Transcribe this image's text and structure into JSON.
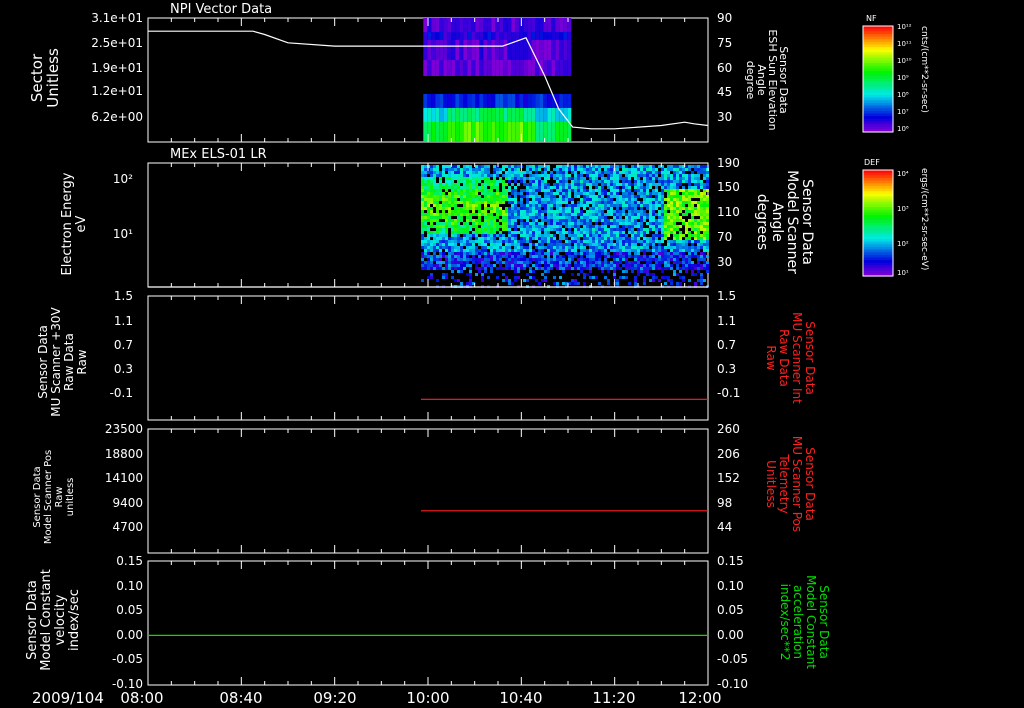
{
  "colors": {
    "background": "#000000",
    "axis": "#ffffff",
    "red": "#ff2020",
    "green": "#00e000"
  },
  "time_axis": {
    "date_label": "2009/104",
    "tick_labels": [
      "08:00",
      "08:40",
      "09:20",
      "10:00",
      "10:40",
      "11:20",
      "12:00"
    ],
    "range_minutes": [
      480,
      720
    ]
  },
  "chart_data": [
    {
      "type": "heatmap",
      "title": "NPI Vector Data",
      "ylabel_left": [
        "Sector",
        "Unitless"
      ],
      "left_tick_labels": [
        "3.1e+01",
        "2.5e+01",
        "1.9e+01",
        "1.2e+01",
        "6.2e+00"
      ],
      "ylabel_right": [
        "Sensor Data",
        "ESH Sun Elevation",
        "Angle",
        "degree"
      ],
      "right_tick_labels": [
        "90",
        "75",
        "60",
        "45",
        "30"
      ],
      "right_ylim": [
        15,
        90
      ],
      "heatmap_extent_minutes": [
        598,
        660
      ],
      "line_series": {
        "name": "ESH Sun Elevation Angle",
        "x": [
          480,
          525,
          530,
          540,
          560,
          600,
          620,
          632,
          636,
          642,
          650,
          656,
          662,
          670,
          680,
          700,
          710,
          714,
          720
        ],
        "y": [
          82,
          82,
          80,
          75,
          73,
          73,
          73,
          73,
          75,
          78,
          55,
          35,
          24,
          23,
          23,
          25,
          27,
          26,
          25
        ]
      },
      "colorbar": {
        "label": "NF",
        "units": "cnts/(cm**2-sr-sec)",
        "tick_labels": [
          "10¹²",
          "10¹¹",
          "10¹⁰",
          "10⁹",
          "10⁸",
          "10⁷",
          "10⁶"
        ]
      }
    },
    {
      "type": "heatmap",
      "title": "MEx ELS-01 LR",
      "ylabel_left": [
        "Electron Energy",
        "eV"
      ],
      "left_tick_labels": [
        "10²",
        "10¹"
      ],
      "ylabel_right": [
        "Sensor Data",
        "Model Scanner",
        "Angle",
        "degrees"
      ],
      "right_tick_labels": [
        "190",
        "150",
        "110",
        "70",
        "30"
      ],
      "right_ylim": [
        10,
        190
      ],
      "heatmap_extent_minutes": [
        597,
        720
      ],
      "line_series": {
        "name": "Model Scanner Angle",
        "x": [
          480,
          720
        ],
        "y": [
          10,
          10
        ]
      },
      "colorbar": {
        "label": "DEF",
        "units": "ergs/(cm**2-sr-sec-eV)",
        "tick_labels": [
          "10⁴",
          "10³",
          "10²",
          "10¹"
        ]
      }
    },
    {
      "type": "line",
      "ylabel_left": [
        "Sensor Data",
        "MU Scanner +30V",
        "Raw Data",
        "Raw"
      ],
      "left_tick_labels": [
        "1.5",
        "1.1",
        "0.7",
        "0.3",
        "-0.1"
      ],
      "left_ylim": [
        -0.3,
        1.5
      ],
      "ylabel_right": [
        "Sensor Data",
        "MU Scanner Int",
        "Raw Data",
        "Raw"
      ],
      "right_tick_labels": [
        "1.5",
        "1.1",
        "0.7",
        "0.3",
        "-0.1"
      ],
      "right_ylim": [
        -0.3,
        1.5
      ],
      "series": [
        {
          "color": "red",
          "x": [
            597,
            720
          ],
          "y": [
            0.0,
            0.0
          ]
        }
      ]
    },
    {
      "type": "line",
      "ylabel_left": [
        "Sensor Data",
        "Model Scanner Pos",
        "Raw",
        "unitless"
      ],
      "left_tick_labels": [
        "23500",
        "18800",
        "14100",
        "9400",
        "4700"
      ],
      "left_ylim": [
        0,
        23500
      ],
      "ylabel_right": [
        "Sensor Data",
        "MU Scanner Pos",
        "Telemetry",
        "Unitless"
      ],
      "right_tick_labels": [
        "260",
        "206",
        "152",
        "98",
        "44"
      ],
      "right_ylim": [
        0,
        260
      ],
      "series": [
        {
          "color": "red",
          "x": [
            597,
            720
          ],
          "y": [
            8000,
            8000
          ]
        }
      ]
    },
    {
      "type": "line",
      "ylabel_left": [
        "Sensor Data",
        "Model Constant",
        "velocity",
        "index/sec"
      ],
      "left_tick_labels": [
        "0.15",
        "0.10",
        "0.05",
        "0.00",
        "-0.05",
        "-0.10"
      ],
      "left_ylim": [
        -0.1,
        0.15
      ],
      "ylabel_right": [
        "Sensor Data",
        "Model Constant",
        "acceleration",
        "index/sec**2"
      ],
      "right_tick_labels": [
        "0.15",
        "0.10",
        "0.05",
        "0.00",
        "-0.05",
        "-0.10"
      ],
      "right_ylim": [
        -0.1,
        0.15
      ],
      "series": [
        {
          "color": "green",
          "x": [
            480,
            720
          ],
          "y": [
            0.0,
            0.0
          ]
        }
      ]
    }
  ]
}
